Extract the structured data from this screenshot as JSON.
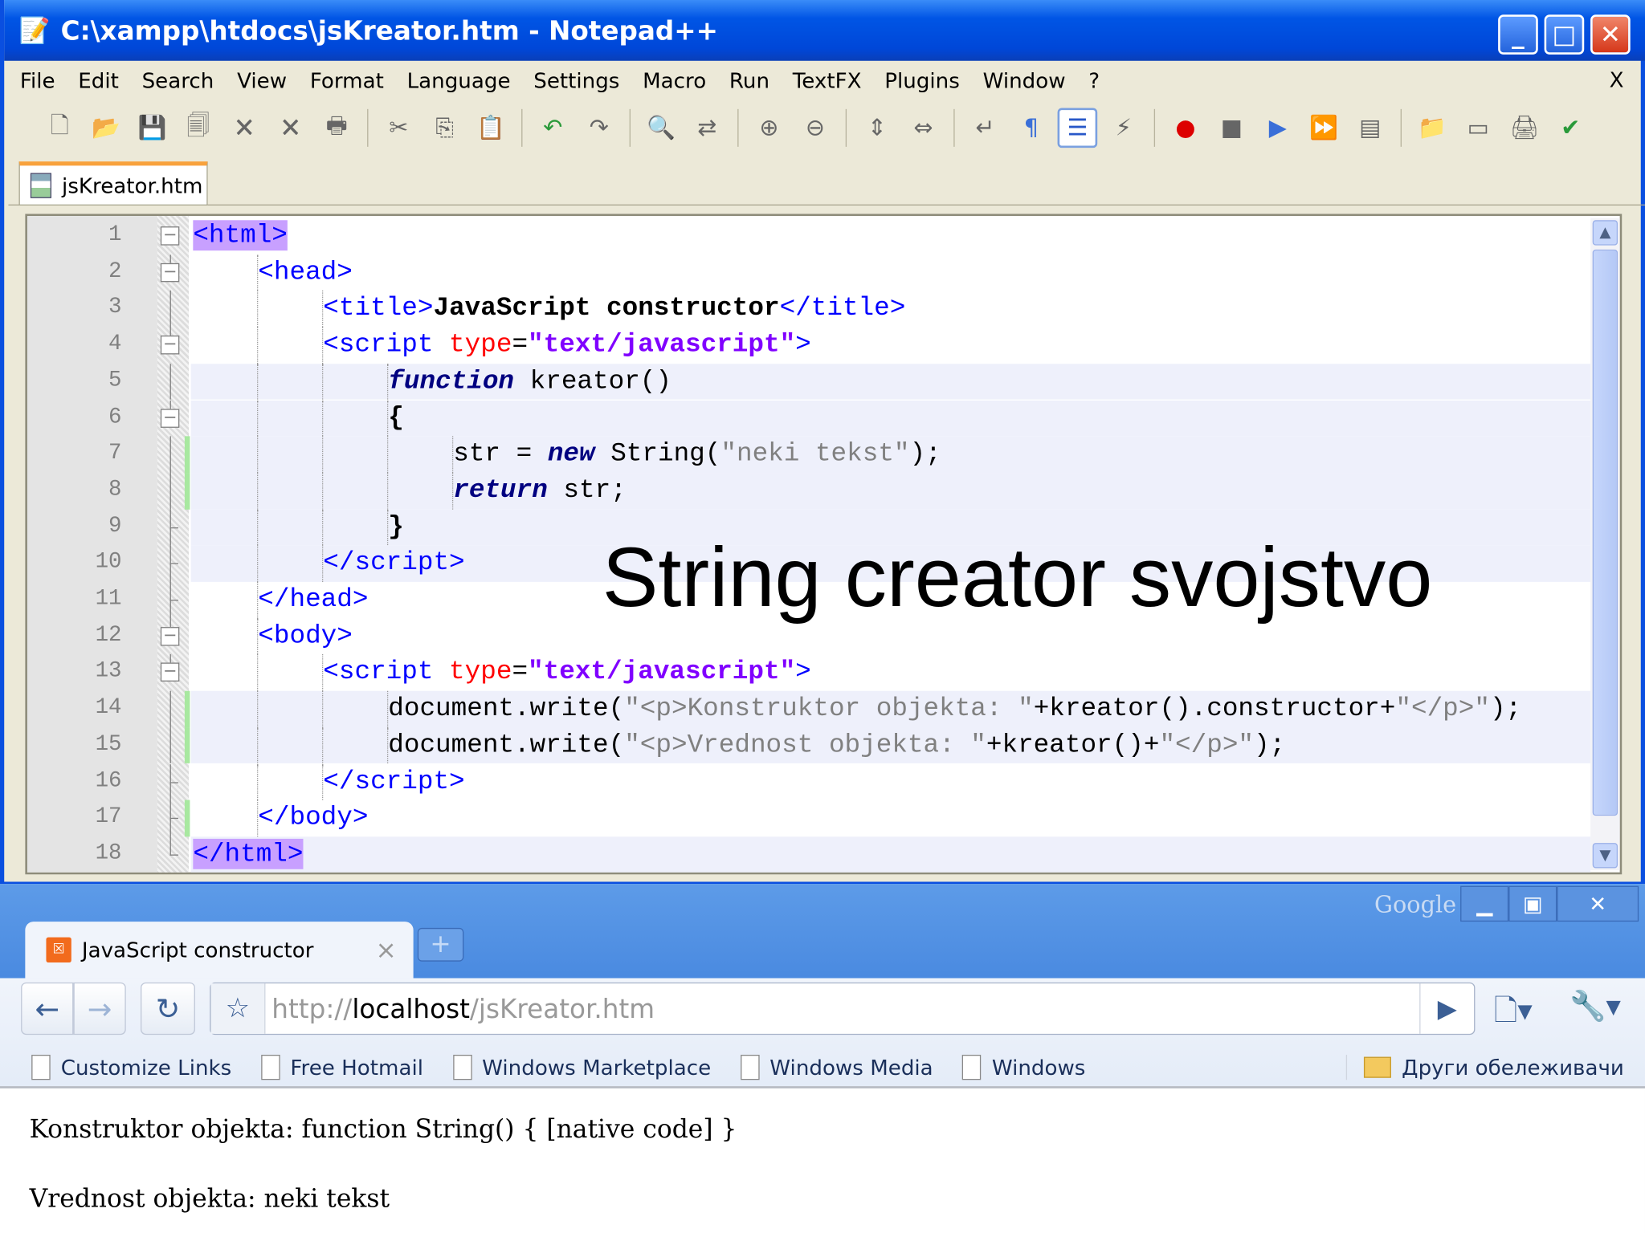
{
  "npp": {
    "title": "C:\\xampp\\htdocs\\jsKreator.htm - Notepad++",
    "menu": [
      "File",
      "Edit",
      "Search",
      "View",
      "Format",
      "Language",
      "Settings",
      "Macro",
      "Run",
      "TextFX",
      "Plugins",
      "Window",
      "?"
    ],
    "menu_close": "X",
    "toolbar_icons": [
      "new-file",
      "open-file",
      "save",
      "save-all",
      "close",
      "close-all",
      "print",
      "|",
      "cut",
      "copy",
      "paste",
      "|",
      "undo",
      "redo",
      "|",
      "find",
      "replace",
      "|",
      "zoom-in",
      "zoom-out",
      "|",
      "sync-vertical",
      "sync-horizontal",
      "|",
      "word-wrap",
      "show-all-chars",
      "indent-guide",
      "user-language",
      "|",
      "record-macro",
      "stop-record",
      "play-macro",
      "run-macro-multiple",
      "save-macro",
      "|",
      "open-folder",
      "console",
      "print-now",
      "spell-check"
    ],
    "tab": "jsKreator.htm",
    "lines": [
      {
        "n": "1",
        "indent": 0,
        "fold": "box",
        "tokens": [
          {
            "c": "mark",
            "t": "<html>"
          }
        ]
      },
      {
        "n": "2",
        "indent": 1,
        "fold": "box",
        "tokens": [
          {
            "c": "tag",
            "t": "<head>"
          }
        ]
      },
      {
        "n": "3",
        "indent": 2,
        "fold": "line",
        "tokens": [
          {
            "c": "tag",
            "t": "<title>"
          },
          {
            "c": "bold",
            "t": "JavaScript constructor"
          },
          {
            "c": "tag",
            "t": "</title>"
          }
        ]
      },
      {
        "n": "4",
        "indent": 2,
        "fold": "box",
        "tokens": [
          {
            "c": "tag",
            "t": "<script "
          },
          {
            "c": "attr",
            "t": "type"
          },
          {
            "c": "txt",
            "t": "="
          },
          {
            "c": "str",
            "t": "\"text/javascript\""
          },
          {
            "c": "tag",
            "t": ">"
          }
        ]
      },
      {
        "n": "5",
        "indent": 3,
        "fold": "line",
        "hl": true,
        "tokens": [
          {
            "c": "kw",
            "t": "function"
          },
          {
            "c": "txt",
            "t": " kreator()"
          }
        ]
      },
      {
        "n": "6",
        "indent": 3,
        "fold": "box",
        "hl": true,
        "tokens": [
          {
            "c": "bold",
            "t": "{"
          }
        ]
      },
      {
        "n": "7",
        "indent": 4,
        "fold": "line",
        "hl": true,
        "chg": true,
        "tokens": [
          {
            "c": "txt",
            "t": "str = "
          },
          {
            "c": "kw",
            "t": "new"
          },
          {
            "c": "txt",
            "t": " String("
          },
          {
            "c": "strlit",
            "t": "\"neki tekst\""
          },
          {
            "c": "txt",
            "t": ");"
          }
        ]
      },
      {
        "n": "8",
        "indent": 4,
        "fold": "line",
        "hl": true,
        "chg": true,
        "tokens": [
          {
            "c": "kw",
            "t": "return"
          },
          {
            "c": "txt",
            "t": " str;"
          }
        ]
      },
      {
        "n": "9",
        "indent": 3,
        "fold": "end",
        "hl": true,
        "tokens": [
          {
            "c": "bold",
            "t": "}"
          }
        ]
      },
      {
        "n": "10",
        "indent": 2,
        "fold": "end",
        "hl": true,
        "tokens": [
          {
            "c": "tag",
            "t": "</script>"
          }
        ]
      },
      {
        "n": "11",
        "indent": 1,
        "fold": "end",
        "tokens": [
          {
            "c": "tag",
            "t": "</head>"
          }
        ]
      },
      {
        "n": "12",
        "indent": 1,
        "fold": "box",
        "tokens": [
          {
            "c": "tag",
            "t": "<body>"
          }
        ]
      },
      {
        "n": "13",
        "indent": 2,
        "fold": "box",
        "tokens": [
          {
            "c": "tag",
            "t": "<script "
          },
          {
            "c": "attr",
            "t": "type"
          },
          {
            "c": "txt",
            "t": "="
          },
          {
            "c": "str",
            "t": "\"text/javascript\""
          },
          {
            "c": "tag",
            "t": ">"
          }
        ]
      },
      {
        "n": "14",
        "indent": 3,
        "fold": "line",
        "hl": true,
        "chg": true,
        "tokens": [
          {
            "c": "txt",
            "t": "document.write("
          },
          {
            "c": "strlit",
            "t": "\"<p>Konstruktor objekta: \""
          },
          {
            "c": "txt",
            "t": "+kreator().constructor+"
          },
          {
            "c": "strlit",
            "t": "\"</p>\""
          },
          {
            "c": "txt",
            "t": ");"
          }
        ]
      },
      {
        "n": "15",
        "indent": 3,
        "fold": "line",
        "hl": true,
        "chg": true,
        "tokens": [
          {
            "c": "txt",
            "t": "document.write("
          },
          {
            "c": "strlit",
            "t": "\"<p>Vrednost objekta: \""
          },
          {
            "c": "txt",
            "t": "+kreator()+"
          },
          {
            "c": "strlit",
            "t": "\"</p>\""
          },
          {
            "c": "txt",
            "t": ");"
          }
        ]
      },
      {
        "n": "16",
        "indent": 2,
        "fold": "end",
        "tokens": [
          {
            "c": "tag",
            "t": "</script>"
          }
        ]
      },
      {
        "n": "17",
        "indent": 1,
        "fold": "end",
        "chg": true,
        "tokens": [
          {
            "c": "tag",
            "t": "</body>"
          }
        ]
      },
      {
        "n": "18",
        "indent": 0,
        "fold": "end",
        "hl": true,
        "tokens": [
          {
            "c": "mark",
            "t": "</html>"
          }
        ]
      }
    ]
  },
  "overlay_caption": "String creator svojstvo",
  "chrome": {
    "brand": "Google",
    "tab_title": "JavaScript constructor",
    "tab_close": "×",
    "new_tab": "+",
    "url_scheme": "http://",
    "url_host": "localhost",
    "url_path": "/jsKreator.htm",
    "bookmarks": [
      "Customize Links",
      "Free Hotmail",
      "Windows Marketplace",
      "Windows Media",
      "Windows"
    ],
    "other_bookmarks": "Други обележивачи",
    "content": [
      "Konstruktor objekta: function String() { [native code] }",
      "Vrednost objekta: neki tekst"
    ]
  }
}
